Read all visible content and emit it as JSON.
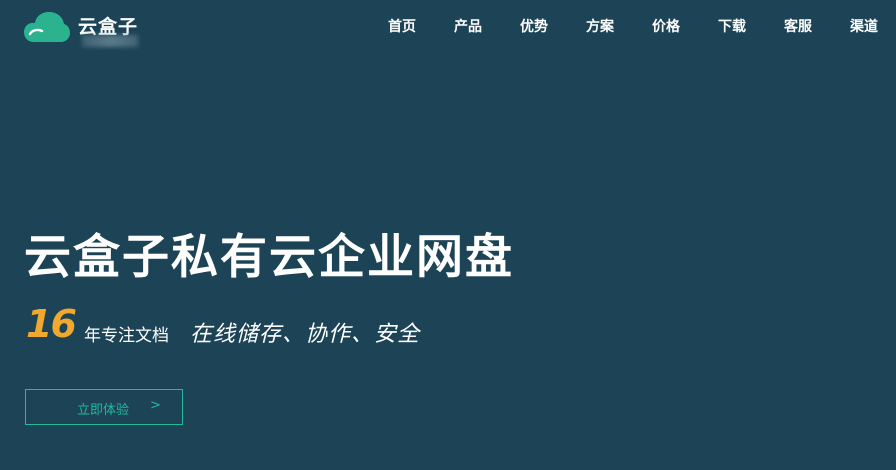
{
  "brand": {
    "name": "云盒子",
    "logo_color": "#2bb38f"
  },
  "nav": {
    "items": [
      {
        "label": "首页"
      },
      {
        "label": "产品"
      },
      {
        "label": "优势"
      },
      {
        "label": "方案"
      },
      {
        "label": "价格"
      },
      {
        "label": "下载"
      },
      {
        "label": "客服"
      },
      {
        "label": "渠道"
      }
    ]
  },
  "hero": {
    "title": "云盒子私有云企业网盘",
    "years_number": "16",
    "years_text": "年专注文档",
    "slogan": "在线储存、协作、安全",
    "cta_label": "立即体验",
    "cta_arrow": ">"
  },
  "colors": {
    "background": "#1c4456",
    "accent": "#25b89a",
    "highlight": "#f0a82e"
  }
}
